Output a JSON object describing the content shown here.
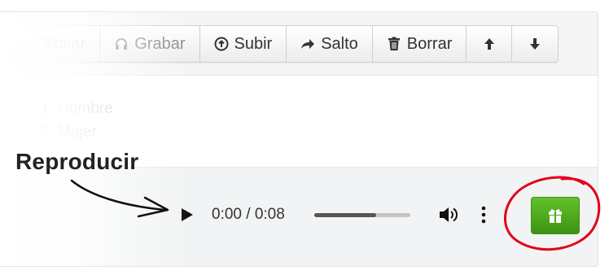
{
  "toolbar": {
    "buttons": [
      {
        "label": "Editar",
        "icon": "pencil-icon",
        "state": "disabled"
      },
      {
        "label": "Grabar",
        "icon": "headset-icon",
        "state": "muted"
      },
      {
        "label": "Subir",
        "icon": "upload-circle-icon",
        "state": "normal"
      },
      {
        "label": "Salto",
        "icon": "share-arrow-icon",
        "state": "normal"
      },
      {
        "label": "Borrar",
        "icon": "trash-icon",
        "state": "normal"
      },
      {
        "label": "",
        "icon": "arrow-up-icon",
        "state": "normal"
      },
      {
        "label": "",
        "icon": "arrow-down-icon",
        "state": "normal"
      }
    ]
  },
  "options": [
    "1. Hombre",
    "2. Mujer"
  ],
  "player": {
    "time": "0:00 / 0:08",
    "progress": 0.64
  },
  "annotation": {
    "label": "Reproducir",
    "color": "#e3001b"
  },
  "gift_button": {
    "icon": "gift-icon",
    "color": "#4ea81d"
  }
}
